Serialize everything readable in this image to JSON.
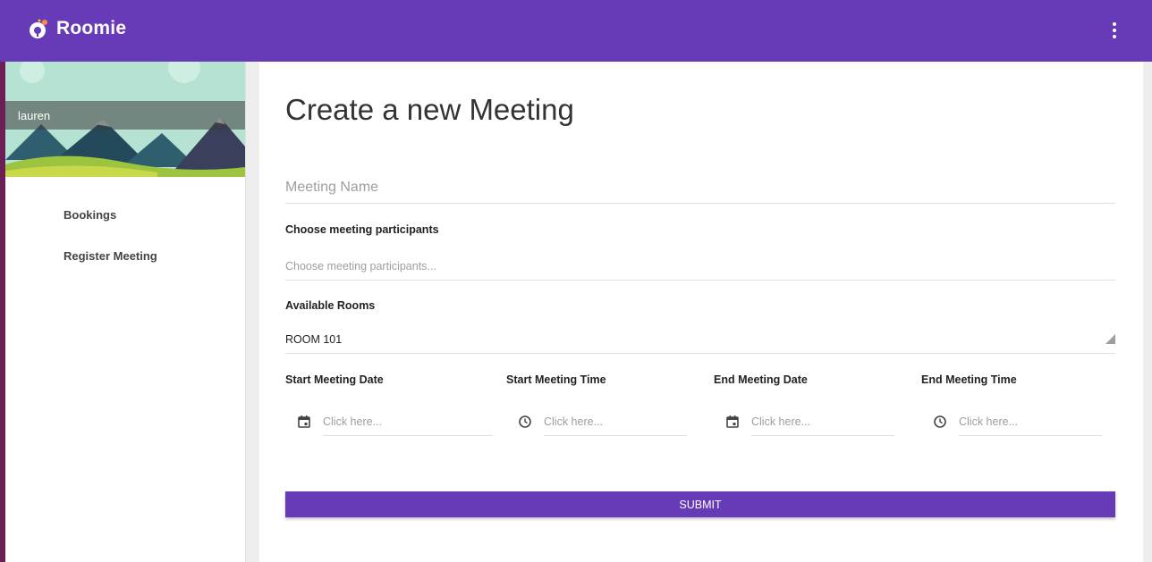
{
  "app": {
    "name": "Roomie"
  },
  "sidebar": {
    "username": "lauren",
    "items": [
      {
        "label": "Bookings"
      },
      {
        "label": "Register Meeting"
      }
    ]
  },
  "form": {
    "title": "Create a new Meeting",
    "meeting_name_placeholder": "Meeting Name",
    "participants_label": "Choose meeting participants",
    "participants_placeholder": "Choose meeting participants...",
    "rooms_label": "Available Rooms",
    "room_selected": "ROOM 101",
    "start_date_label": "Start Meeting Date",
    "start_time_label": "Start Meeting Time",
    "end_date_label": "End Meeting Date",
    "end_time_label": "End Meeting Time",
    "picker_placeholder": "Click here...",
    "submit_label": "SUBMIT"
  },
  "icons": {
    "menu": "more-vert-icon",
    "date": "calendar-icon",
    "time": "clock-icon"
  },
  "colors": {
    "primary": "#673ab7",
    "desktop": "#6b1f55"
  }
}
